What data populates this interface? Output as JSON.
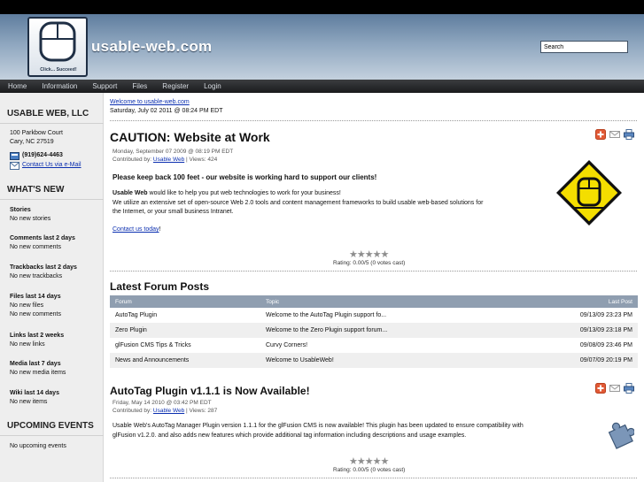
{
  "header": {
    "site_name": "usable-web.com",
    "tagline": "Click... Succeed!",
    "search_placeholder": "Search"
  },
  "nav": [
    "Home",
    "Information",
    "Support",
    "Files",
    "Register",
    "Login"
  ],
  "sidebar": {
    "company_title": "USABLE WEB, LLC",
    "address_line1": "100 Parkbow Court",
    "address_line2": "Cary, NC  27519",
    "phone": "(919)624-4463",
    "email_link": "Contact Us via e-Mail",
    "whats_new_title": "WHAT'S NEW",
    "sections": [
      {
        "title": "Stories",
        "lines": [
          "No new stories"
        ]
      },
      {
        "title": "Comments last 2 days",
        "lines": [
          "No new comments"
        ]
      },
      {
        "title": "Trackbacks last 2 days",
        "lines": [
          "No new trackbacks"
        ]
      },
      {
        "title": "Files last 14 days",
        "lines": [
          "No new files",
          "No new comments"
        ]
      },
      {
        "title": "Links last 2 weeks",
        "lines": [
          "No new links"
        ]
      },
      {
        "title": "Media last 7 days",
        "lines": [
          "No new media items"
        ]
      },
      {
        "title": "Wiki last 14 days",
        "lines": [
          "No new items"
        ]
      }
    ],
    "upcoming_title": "UPCOMING EVENTS",
    "upcoming_text": "No upcoming events"
  },
  "main": {
    "welcome_link": "Welcome to usable-web.com",
    "date": "Saturday, July 02 2011 @ 08:24 PM EDT",
    "article1": {
      "title": "CAUTION: Website at Work",
      "meta_date": "Monday, September 07 2009 @ 08:19 PM EDT",
      "contributed_by": "Contributed by:",
      "author": "Usable Web",
      "views": "|  Views: 424",
      "headline": "Please keep back 100 feet - our website is working hard to support our clients!",
      "body_bold": "Usable Web",
      "body_line1": " would like to help you put web technologies to work for your business!",
      "body_line2": "We utilize an extensive set of open-source Web 2.0 tools and content management frameworks to build usable web-based solutions for",
      "body_line3": "the Internet, or your small business Intranet.",
      "contact_link": "Contact us today",
      "contact_suffix": "!",
      "rating_text": "Rating: 0.00/5 (0 votes cast)"
    },
    "forum": {
      "title": "Latest Forum Posts",
      "headers": [
        "Forum",
        "Topic",
        "Last Post"
      ],
      "rows": [
        [
          "AutoTag Plugin",
          "Welcome to the AutoTag Plugin support fo...",
          "09/13/09 23:23 PM"
        ],
        [
          "Zero Plugin",
          "Welcome to the Zero Plugin support forum...",
          "09/13/09 23:18 PM"
        ],
        [
          "glFusion CMS Tips & Tricks",
          "Curvy Corners!",
          "09/08/09 23:46 PM"
        ],
        [
          "News and Announcements",
          "Welcome to UsableWeb!",
          "09/07/09 20:19 PM"
        ]
      ]
    },
    "article2": {
      "title": "AutoTag Plugin v1.1.1 is Now Available!",
      "meta_date": "Friday, May 14 2010 @ 03:42 PM EDT",
      "contributed_by": "Contributed by:",
      "author": "Usable Web",
      "views": "|  Views: 287",
      "body_line1": "Usable Web's AutoTag Manager Plugin version 1.1.1 for the glFusion CMS is now available!  This plugin has been updated to ensure compatibility with",
      "body_line2": "glFusion v1.2.0. and also adds new features which provide additional tag information including descriptions and usage examples.",
      "rating_text": "Rating: 0.00/5 (0 votes cast)"
    }
  },
  "colors": {
    "link": "#0b2fb0",
    "nav_bg": "#2a2b2e",
    "table_header": "#8f9eb0",
    "caution_yellow": "#f4de00"
  }
}
